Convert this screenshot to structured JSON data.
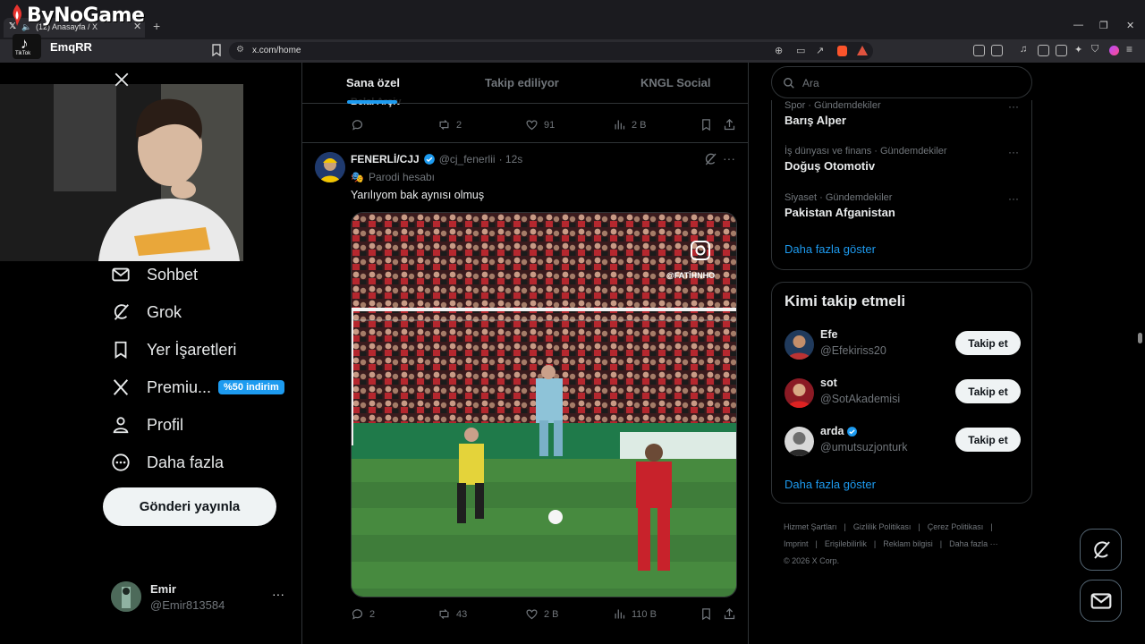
{
  "browser": {
    "tab_title": "(12) Anasayfa / X",
    "url": "x.com/home"
  },
  "overlay": {
    "logo_text": "ByNoGame",
    "tiktok_label": "TikTok",
    "tiktok_user": "EmqRR"
  },
  "nav": {
    "items": [
      {
        "label": "Sohbet",
        "icon": "mail-icon"
      },
      {
        "label": "Grok",
        "icon": "grok-icon"
      },
      {
        "label": "Yer İşaretleri",
        "icon": "bookmark-icon"
      },
      {
        "label": "Premiu...",
        "icon": "x-logo-icon"
      },
      {
        "label": "Profil",
        "icon": "person-icon"
      },
      {
        "label": "Daha fazla",
        "icon": "more-circle-icon"
      }
    ],
    "premium_badge": "%50 indirim",
    "post_button": "Gönderi yayınla",
    "account": {
      "name": "Emir",
      "handle": "@Emir813584",
      "more": "···"
    }
  },
  "timeline": {
    "tabs": [
      "Sana özel",
      "Takip ediliyor",
      "KNGL Social"
    ],
    "prev_tweet": {
      "author_snippet": "Belal Arşiv",
      "replies": "",
      "retweets": "2",
      "likes": "91",
      "views": "2 B"
    },
    "tweet": {
      "name": "FENERLİ/CJJ",
      "handle": "@cj_fenerlii",
      "time": "· 12s",
      "parody": "Parodi hesabı",
      "text": "Yarılıyom bak aynısı olmuş",
      "media_watermark": "@FATİHNHO",
      "replies": "2",
      "retweets": "43",
      "likes": "2 B",
      "views": "110 B"
    }
  },
  "right": {
    "search_placeholder": "Ara",
    "trends": [
      {
        "category": "Spor · Gündemdekiler",
        "name": "Barış Alper"
      },
      {
        "category": "İş dünyası ve finans · Gündemdekiler",
        "name": "Doğuş Otomotiv"
      },
      {
        "category": "Siyaset · Gündemdekiler",
        "name": "Pakistan Afganistan"
      }
    ],
    "trends_show_more": "Daha fazla göster",
    "follow_title": "Kimi takip etmeli",
    "follow": [
      {
        "name": "Efe",
        "handle": "@Efekiriss20",
        "button": "Takip et",
        "verified": false
      },
      {
        "name": "sot",
        "handle": "@SotAkademisi",
        "button": "Takip et",
        "verified": false
      },
      {
        "name": "arda",
        "handle": "@umutsuzjonturk",
        "button": "Takip et",
        "verified": true
      }
    ],
    "follow_show_more": "Daha fazla göster",
    "footer": {
      "links1": [
        "Hizmet Şartları",
        "|",
        "Gizlilik Politikası",
        "|",
        "Çerez Politikası",
        "|"
      ],
      "links2": [
        "Imprint",
        "|",
        "Erişilebilirlik",
        "|",
        "Reklam bilgisi",
        "|",
        "Daha fazla ···"
      ],
      "copyright": "© 2026 X Corp."
    }
  },
  "colors": {
    "accent": "#1d9bf0",
    "bg": "#000000",
    "muted": "#71767b"
  }
}
